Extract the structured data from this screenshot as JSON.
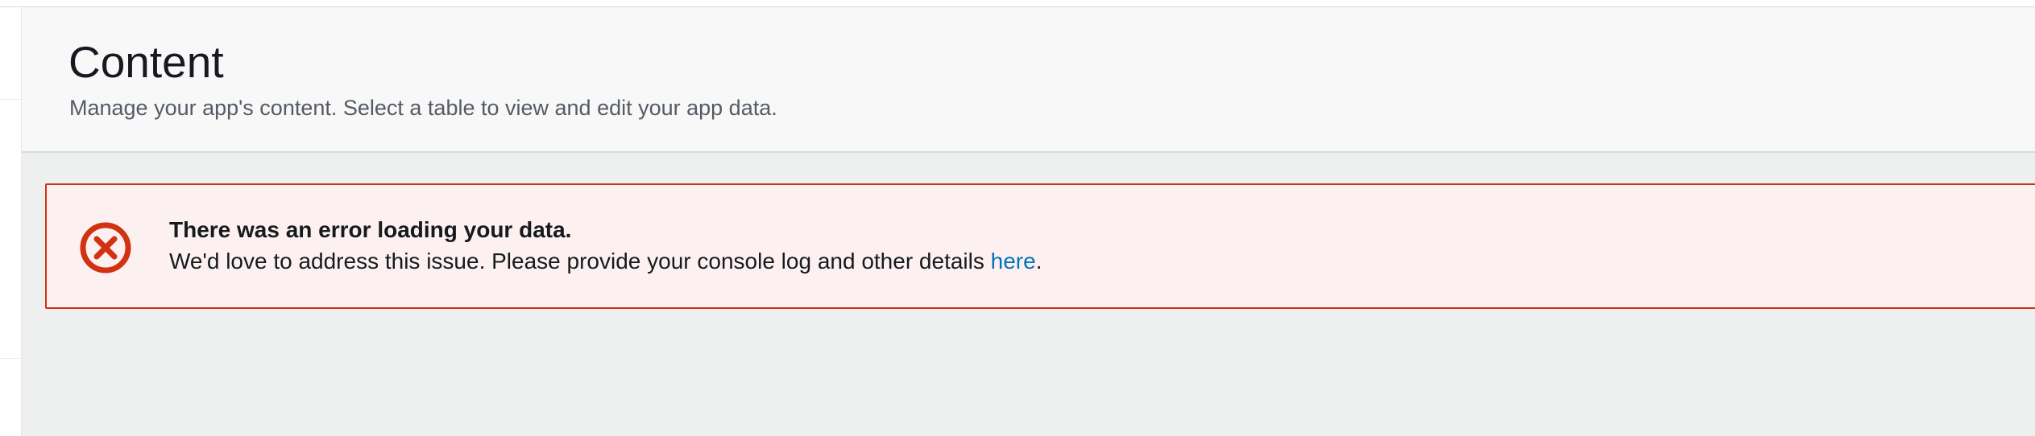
{
  "page": {
    "title": "Content",
    "subtitle": "Manage your app's content. Select a table to view and edit your app data."
  },
  "alert": {
    "type": "error",
    "icon": "error-circle-x-icon",
    "title": "There was an error loading your data.",
    "message_prefix": "We'd love to address this issue. Please provide your console log and other details ",
    "link_label": "here",
    "message_suffix": "."
  },
  "colors": {
    "error_red": "#d13212",
    "alert_background": "#fcf1f0",
    "link_blue": "#0073bb",
    "header_background": "#f8f8f8",
    "content_background": "#eeefef"
  }
}
